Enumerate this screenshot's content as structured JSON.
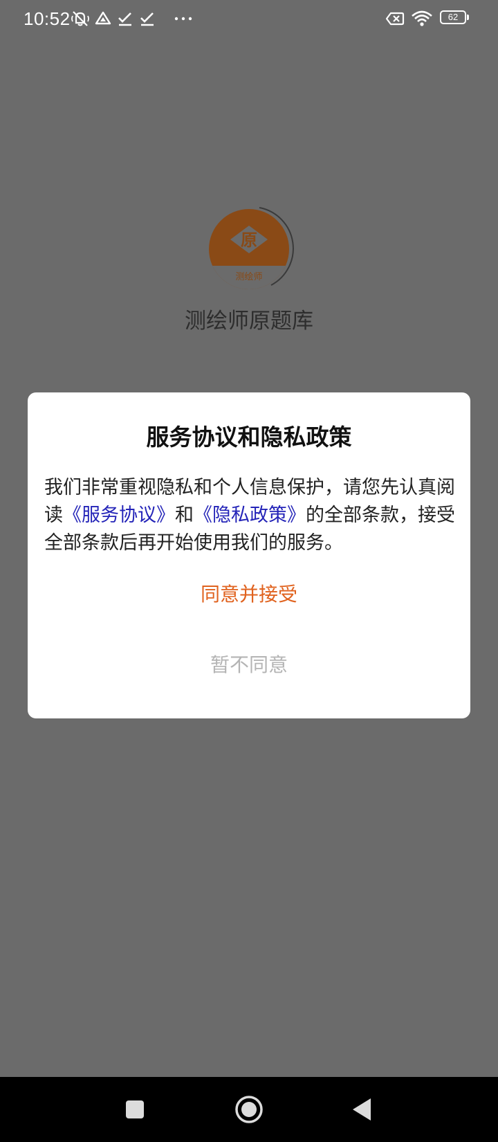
{
  "status_bar": {
    "time": "10:52",
    "battery_level": "62",
    "icons": [
      "mute-icon",
      "drive-icon",
      "check-icon",
      "check-icon",
      "more-dots-icon",
      "sim-error-icon",
      "wifi-icon",
      "battery-icon"
    ]
  },
  "splash": {
    "logo_text_main": "原",
    "logo_text_sub": "测绘师",
    "app_name": "测绘师原题库"
  },
  "dialog": {
    "title": "服务协议和隐私政策",
    "body_part1": "我们非常重视隐私和个人信息保护，请您先认真阅读",
    "link_service": "《服务协议》",
    "body_part2": "和",
    "link_privacy": "《隐私政策》",
    "body_part3": "的全部条款，接受全部条款后再开始使用我们的服务。",
    "agree_label": "同意并接受",
    "decline_label": "暂不同意"
  },
  "nav_bar": {
    "buttons": [
      "recents-square-icon",
      "home-circle-icon",
      "back-triangle-icon"
    ]
  },
  "colors": {
    "overlay_background": "#6b6b6b",
    "logo_brown": "#8a4a16",
    "link_blue": "#2424b8",
    "accent_orange": "#e0621e",
    "decline_gray": "#b4b4b4"
  }
}
